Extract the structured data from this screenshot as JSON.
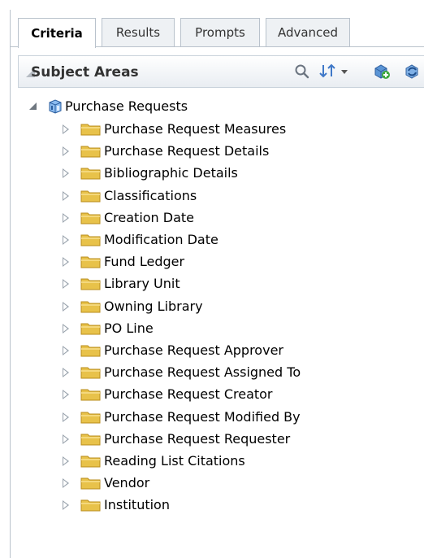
{
  "tabs": [
    {
      "label": "Criteria",
      "active": true
    },
    {
      "label": "Results",
      "active": false
    },
    {
      "label": "Prompts",
      "active": false
    },
    {
      "label": "Advanced",
      "active": false
    }
  ],
  "panel": {
    "title": "Subject Areas",
    "toolbar_icons": [
      "search-icon",
      "sort-icon",
      "dropdown-arrow-icon",
      "add-subject-area-icon",
      "refresh-icon"
    ]
  },
  "tree": {
    "root": {
      "label": "Purchase Requests",
      "icon": "cube-icon"
    },
    "items": [
      "Purchase Request Measures",
      "Purchase Request Details",
      "Bibliographic Details",
      "Classifications",
      "Creation Date",
      "Modification Date",
      "Fund Ledger",
      "Library Unit",
      "Owning Library",
      "PO Line",
      "Purchase Request Approver",
      "Purchase Request Assigned To",
      "Purchase Request Creator",
      "Purchase Request Modified By",
      "Purchase Request Requester",
      "Reading List Citations",
      "Vendor",
      "Institution"
    ]
  },
  "colors": {
    "border": "#b9c2cc",
    "folder": "#e8c24a",
    "folder_dark": "#b98c1b",
    "cube": "#3d7fc9"
  }
}
